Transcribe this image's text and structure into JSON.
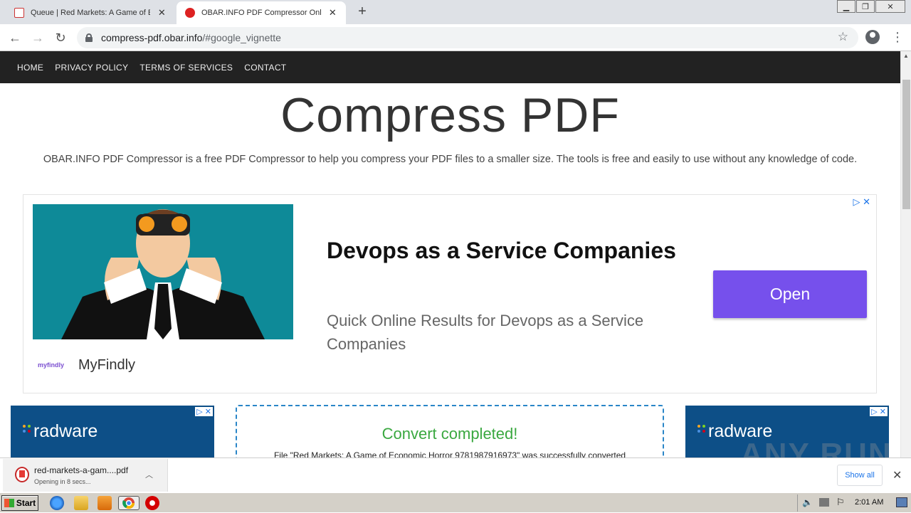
{
  "browser": {
    "tabs": [
      {
        "title": "Queue | Red Markets: A Game of Ec",
        "active": false
      },
      {
        "title": "OBAR.INFO PDF Compressor Online",
        "active": true
      }
    ],
    "url_host": "compress-pdf.obar.info",
    "url_path": "/#google_vignette"
  },
  "site": {
    "nav": [
      "HOME",
      "PRIVACY POLICY",
      "TERMS OF SERVICES",
      "CONTACT"
    ],
    "title": "Compress PDF",
    "intro": "OBAR.INFO PDF Compressor is a free PDF Compressor to help you compress your PDF files to a smaller size. The tools is free and easily to use without any knowledge of code."
  },
  "ad": {
    "headline": "Devops as a Service Companies",
    "description": "Quick Online Results for Devops as a Service Companies",
    "brand": "MyFindly",
    "brand_logo": "myfindly",
    "button": "Open",
    "adchoices": "▷ ✕",
    "side_brand": "radware",
    "button_color": "#7650ec"
  },
  "convert": {
    "status": "Convert completed!",
    "message": "File \"Red Markets: A Game of Economic Horror 9781987916973\" was successfully converted"
  },
  "watermark": "ANY RUN",
  "download": {
    "filename": "red-markets-a-gam....pdf",
    "status": "Opening in 8 secs...",
    "show_all": "Show all"
  },
  "taskbar": {
    "start": "Start",
    "clock": "2:01 AM"
  }
}
